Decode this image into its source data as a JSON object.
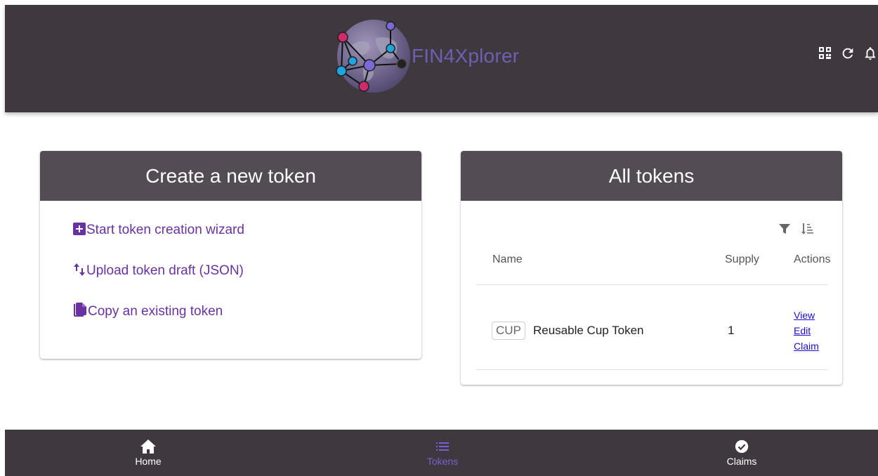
{
  "app": {
    "title": "FIN4Xplorer",
    "logo_icon": "network-globe-logo-icon",
    "top_icons": [
      "qr-code-icon",
      "refresh-icon",
      "bell-icon"
    ]
  },
  "create_card": {
    "title": "Create a new token",
    "items": [
      {
        "label": "Start token creation wizard",
        "icon": "add-box-icon"
      },
      {
        "label": "Upload token draft (JSON)",
        "icon": "import-export-icon"
      },
      {
        "label": "Copy an existing token",
        "icon": "file-copy-icon"
      }
    ]
  },
  "tokens_card": {
    "title": "All tokens",
    "tools": [
      "filter-icon",
      "sort-icon"
    ],
    "columns": {
      "name": "Name",
      "supply": "Supply",
      "actions": "Actions"
    },
    "rows": [
      {
        "symbol": "CUP",
        "name": "Reusable Cup Token",
        "supply": "1",
        "actions": [
          "View",
          "Edit",
          "Claim"
        ]
      }
    ]
  },
  "bottom_nav": {
    "items": [
      {
        "label": "Home",
        "icon": "home-icon"
      },
      {
        "label": "Tokens",
        "icon": "list-icon",
        "active": true
      },
      {
        "label": "Claims",
        "icon": "check-circle-icon"
      }
    ]
  },
  "colors": {
    "bar": "#3f383f",
    "card_header": "#544c54",
    "accent_purple": "#6a31a0",
    "brand_purple": "#6f5fb3",
    "active_nav": "#7a60d0",
    "link": "#1a0dcc"
  }
}
